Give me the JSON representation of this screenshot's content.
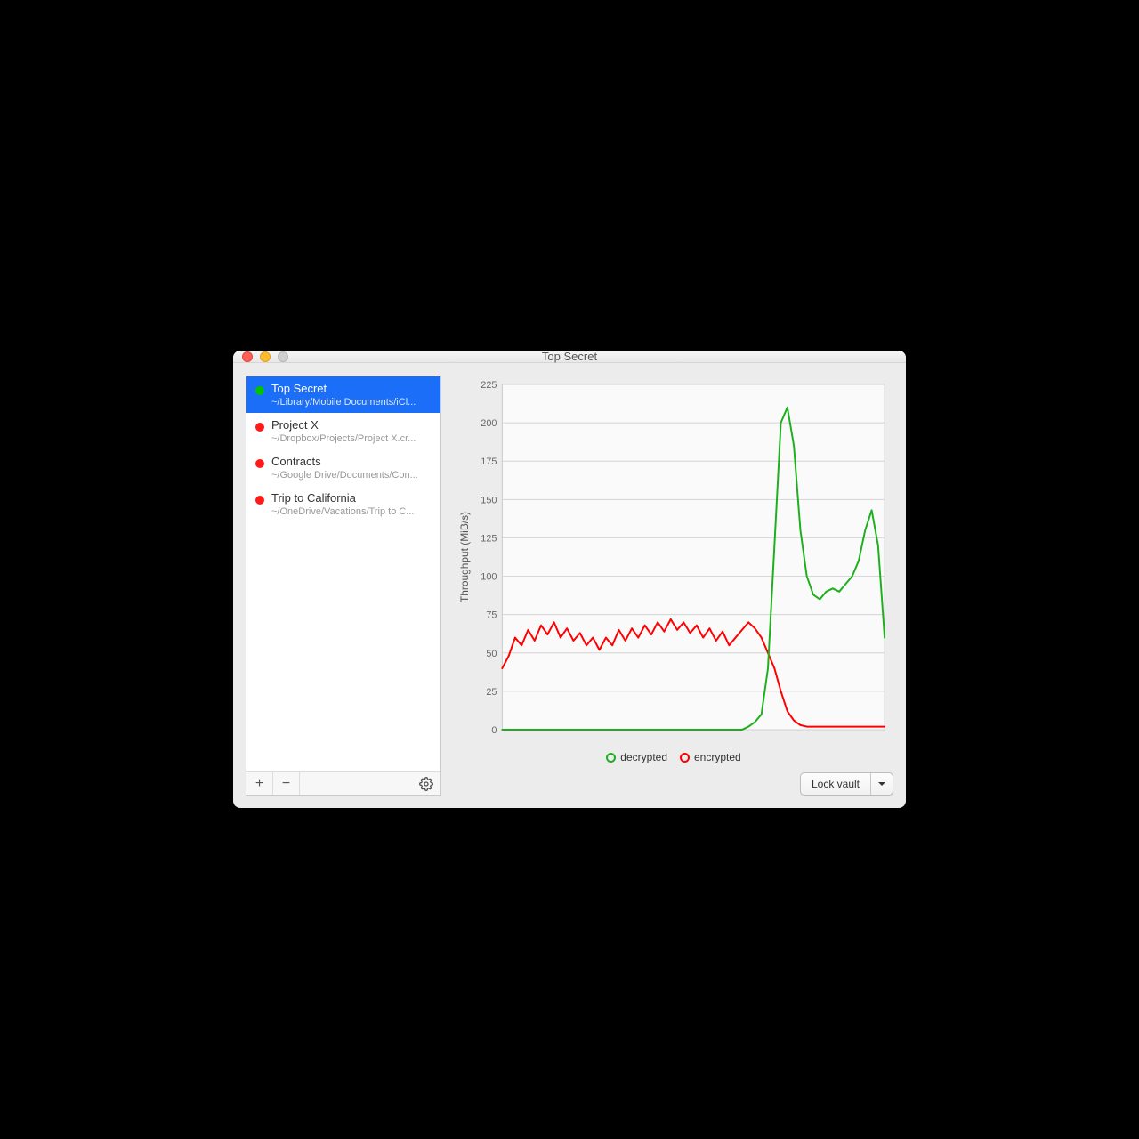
{
  "window": {
    "title": "Top Secret"
  },
  "sidebar": {
    "items": [
      {
        "title": "Top Secret",
        "path": "~/Library/Mobile Documents/iCl...",
        "status": "green",
        "selected": true
      },
      {
        "title": "Project X",
        "path": "~/Dropbox/Projects/Project X.cr...",
        "status": "red",
        "selected": false
      },
      {
        "title": "Contracts",
        "path": "~/Google Drive/Documents/Con...",
        "status": "red",
        "selected": false
      },
      {
        "title": "Trip to California",
        "path": "~/OneDrive/Vacations/Trip to C...",
        "status": "red",
        "selected": false
      }
    ],
    "add_label": "+",
    "remove_label": "−"
  },
  "chart": {
    "ylabel": "Throughput (MiB/s)",
    "legend": {
      "decrypted": {
        "label": "decrypted",
        "color": "#1db01d"
      },
      "encrypted": {
        "label": "encrypted",
        "color": "#ff0000"
      }
    }
  },
  "actions": {
    "lock_label": "Lock vault"
  },
  "chart_data": {
    "type": "line",
    "ylabel": "Throughput (MiB/s)",
    "ylim": [
      0,
      225
    ],
    "yticks": [
      0,
      25,
      50,
      75,
      100,
      125,
      150,
      175,
      200,
      225
    ],
    "x": [
      0,
      1,
      2,
      3,
      4,
      5,
      6,
      7,
      8,
      9,
      10,
      11,
      12,
      13,
      14,
      15,
      16,
      17,
      18,
      19,
      20,
      21,
      22,
      23,
      24,
      25,
      26,
      27,
      28,
      29,
      30,
      31,
      32,
      33,
      34,
      35,
      36,
      37,
      38,
      39,
      40,
      41,
      42,
      43,
      44,
      45,
      46,
      47,
      48,
      49,
      50,
      51,
      52,
      53,
      54,
      55,
      56,
      57,
      58,
      59
    ],
    "series": [
      {
        "name": "encrypted",
        "color": "#ff0000",
        "values": [
          40,
          48,
          60,
          55,
          65,
          58,
          68,
          62,
          70,
          60,
          66,
          58,
          63,
          55,
          60,
          52,
          60,
          55,
          65,
          58,
          66,
          60,
          68,
          62,
          70,
          64,
          72,
          65,
          70,
          63,
          68,
          60,
          66,
          58,
          64,
          55,
          60,
          65,
          70,
          66,
          60,
          50,
          40,
          25,
          12,
          6,
          3,
          2,
          2,
          2,
          2,
          2,
          2,
          2,
          2,
          2,
          2,
          2,
          2,
          2
        ]
      },
      {
        "name": "decrypted",
        "color": "#1db01d",
        "values": [
          0,
          0,
          0,
          0,
          0,
          0,
          0,
          0,
          0,
          0,
          0,
          0,
          0,
          0,
          0,
          0,
          0,
          0,
          0,
          0,
          0,
          0,
          0,
          0,
          0,
          0,
          0,
          0,
          0,
          0,
          0,
          0,
          0,
          0,
          0,
          0,
          0,
          0,
          2,
          5,
          10,
          40,
          120,
          200,
          210,
          185,
          130,
          100,
          88,
          85,
          90,
          92,
          90,
          95,
          100,
          110,
          130,
          143,
          120,
          60
        ]
      }
    ]
  }
}
